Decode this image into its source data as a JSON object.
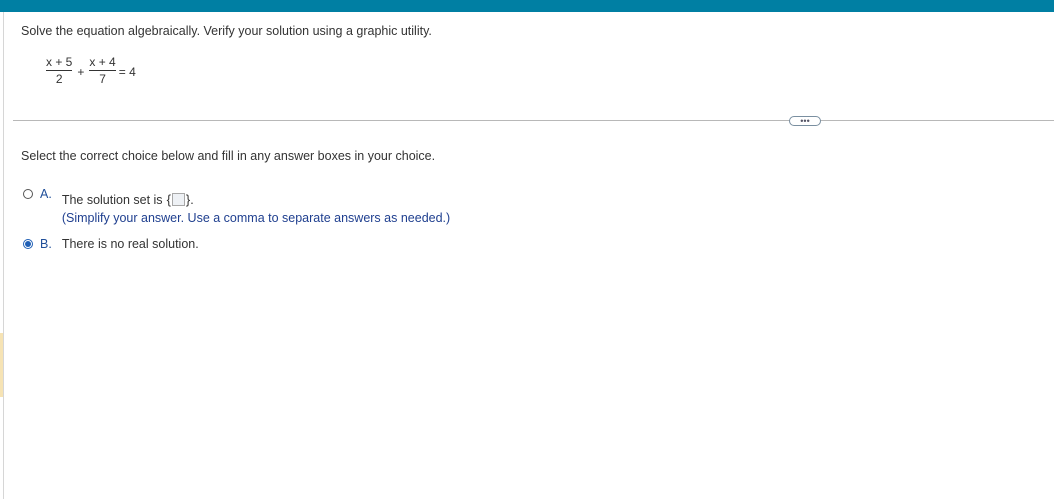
{
  "question": {
    "instructions": "Solve the equation algebraically. Verify your solution using a graphic utility.",
    "equation": {
      "frac1_num": "x + 5",
      "frac1_den": "2",
      "plus": "+",
      "frac2_num": "x + 4",
      "frac2_den": "7",
      "rhs": "= 4"
    }
  },
  "more_button_label": "•••",
  "prompt": "Select the correct choice below and fill in any answer boxes in your choice.",
  "choices": [
    {
      "letter": "A.",
      "text_before": "The solution set is",
      "brace_open": "{",
      "brace_close": "}",
      "text_after": ".",
      "hint": "(Simplify your answer. Use a comma to separate answers as needed.)",
      "selected": false
    },
    {
      "letter": "B.",
      "text": "There is no real solution.",
      "selected": true
    }
  ],
  "colors": {
    "top_bar": "#007fa3",
    "radio_selected": "#1f5fb5",
    "hint_text": "#1f3f8f"
  }
}
